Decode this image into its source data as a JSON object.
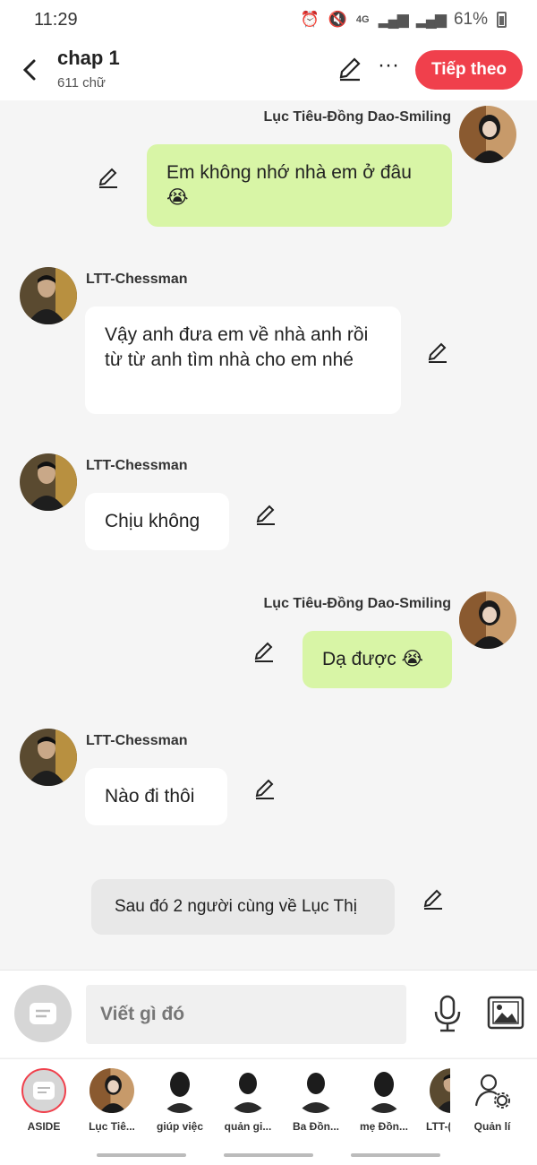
{
  "status": {
    "time": "11:29",
    "network": "4G",
    "battery": "61%"
  },
  "header": {
    "title": "chap 1",
    "subtitle": "611 chữ",
    "next_label": "Tiếp theo"
  },
  "messages": [
    {
      "sender": "Lục Tiêu-Đồng Dao-Smiling",
      "text": "Em không nhớ nhà em ở đâu 😭",
      "side": "right"
    },
    {
      "sender": "LTT-Chessman",
      "text": "Vậy anh đưa em về nhà anh rồi từ từ anh tìm nhà cho em nhé",
      "side": "left"
    },
    {
      "sender": "LTT-Chessman",
      "text": "Chịu không",
      "side": "left"
    },
    {
      "sender": "Lục Tiêu-Đồng Dao-Smiling",
      "text": "Dạ được 😭",
      "side": "right"
    },
    {
      "sender": "LTT-Chessman",
      "text": "Nào đi thôi",
      "side": "left"
    },
    {
      "sender": "",
      "text": "Sau đó 2 người cùng về Lục Thị",
      "side": "narration"
    }
  ],
  "composer": {
    "placeholder": "Viết gì đó"
  },
  "characters": [
    {
      "label": "ASIDE"
    },
    {
      "label": "Lục Tiê..."
    },
    {
      "label": "giúp việc"
    },
    {
      "label": "quản gi..."
    },
    {
      "label": "Ba Đồn..."
    },
    {
      "label": "mẹ Đồn..."
    },
    {
      "label": "LTT-("
    },
    {
      "label": "Quản lí"
    }
  ],
  "colors": {
    "accent": "#f0404c",
    "bubble_self": "#d8f5a6",
    "bubble_other": "#ffffff",
    "narration": "#e8e8e8"
  }
}
